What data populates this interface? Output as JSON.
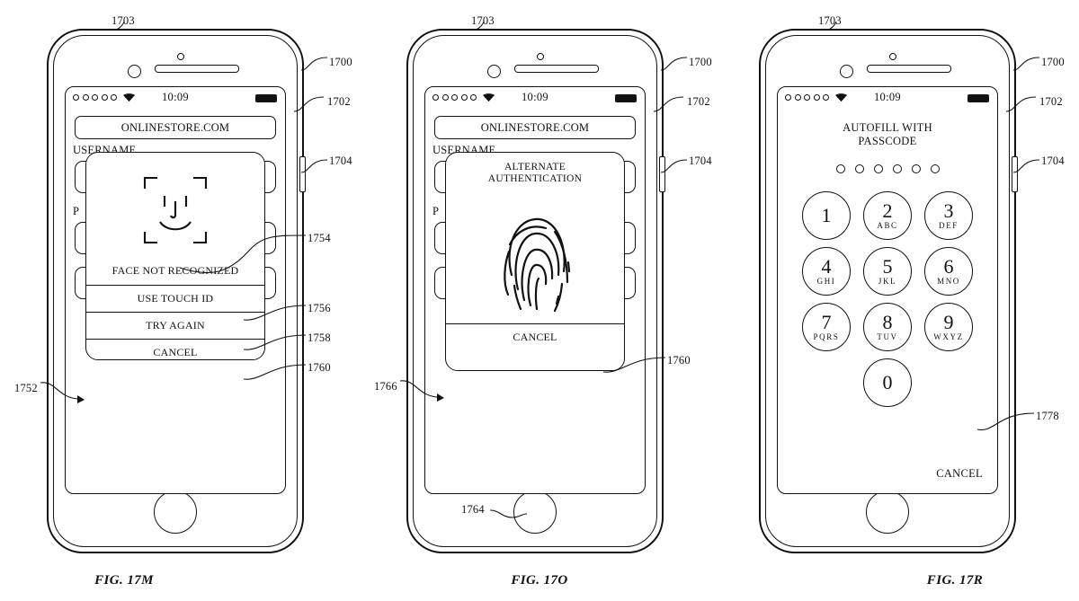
{
  "figure": {
    "sheet_title": "Patent figure sheet FIG. 17M / 17O / 17R",
    "time": "10:09"
  },
  "panels": [
    {
      "caption": "FIG. 17M",
      "screen_type": "browser-form-with-faceid-dialog",
      "status": {
        "time": "10:09",
        "wifi_icon": "wifi-icon",
        "battery_icon": "battery-full-icon",
        "signal_dots": 5
      },
      "browser": {
        "url": "ONLINESTORE.COM",
        "username_label": "USERNAME",
        "password_label": "P",
        "fields": [
          "",
          "",
          ""
        ]
      },
      "dialog": {
        "icon": "face-not-recognized-icon",
        "message": "FACE  NOT RECOGNIZED",
        "actions": [
          "USE TOUCH ID",
          "TRY AGAIN",
          "CANCEL"
        ]
      },
      "refs": [
        {
          "num": "1703",
          "target": "front-camera"
        },
        {
          "num": "1700",
          "target": "device-body"
        },
        {
          "num": "1702",
          "target": "display"
        },
        {
          "num": "1704",
          "target": "side-button"
        },
        {
          "num": "1754",
          "target": "face-icon"
        },
        {
          "num": "1756",
          "target": "use-touch-id-row"
        },
        {
          "num": "1758",
          "target": "try-again-row"
        },
        {
          "num": "1760",
          "target": "cancel-row"
        },
        {
          "num": "1752",
          "target": "dialog"
        }
      ]
    },
    {
      "caption": "FIG. 17O",
      "screen_type": "browser-form-with-touchid-dialog",
      "status": {
        "time": "10:09",
        "wifi_icon": "wifi-icon",
        "battery_icon": "battery-full-icon",
        "signal_dots": 5
      },
      "browser": {
        "url": "ONLINESTORE.COM",
        "username_label": "USERNAME",
        "password_label": "P",
        "fields": [
          "",
          "",
          ""
        ]
      },
      "dialog": {
        "title_line1": "ALTERNATE",
        "title_line2": "AUTHENTICATION",
        "icon": "fingerprint-icon",
        "actions": [
          "CANCEL"
        ]
      },
      "refs": [
        {
          "num": "1703",
          "target": "front-camera"
        },
        {
          "num": "1700",
          "target": "device-body"
        },
        {
          "num": "1702",
          "target": "display"
        },
        {
          "num": "1704",
          "target": "side-button"
        },
        {
          "num": "1760",
          "target": "cancel-row"
        },
        {
          "num": "1766",
          "target": "dialog"
        },
        {
          "num": "1764",
          "target": "home-button"
        }
      ]
    },
    {
      "caption": "FIG. 17R",
      "screen_type": "passcode-entry",
      "status": {
        "time": "10:09",
        "wifi_icon": "wifi-icon",
        "battery_icon": "battery-full-icon",
        "signal_dots": 5
      },
      "passcode": {
        "title_line1": "AUTOFILL WITH",
        "title_line2": "PASSCODE",
        "dot_count": 6,
        "keys": [
          {
            "num": "1",
            "alpha": ""
          },
          {
            "num": "2",
            "alpha": "ABC"
          },
          {
            "num": "3",
            "alpha": "DEF"
          },
          {
            "num": "4",
            "alpha": "GHI"
          },
          {
            "num": "5",
            "alpha": "JKL"
          },
          {
            "num": "6",
            "alpha": "MNO"
          },
          {
            "num": "7",
            "alpha": "PQRS"
          },
          {
            "num": "8",
            "alpha": "TUV"
          },
          {
            "num": "9",
            "alpha": "WXYZ"
          },
          {
            "num": "0",
            "alpha": ""
          }
        ],
        "cancel": "CANCEL"
      },
      "refs": [
        {
          "num": "1703",
          "target": "front-camera"
        },
        {
          "num": "1700",
          "target": "device-body"
        },
        {
          "num": "1702",
          "target": "display"
        },
        {
          "num": "1704",
          "target": "side-button"
        },
        {
          "num": "1778",
          "target": "passcode-screen"
        }
      ]
    }
  ]
}
